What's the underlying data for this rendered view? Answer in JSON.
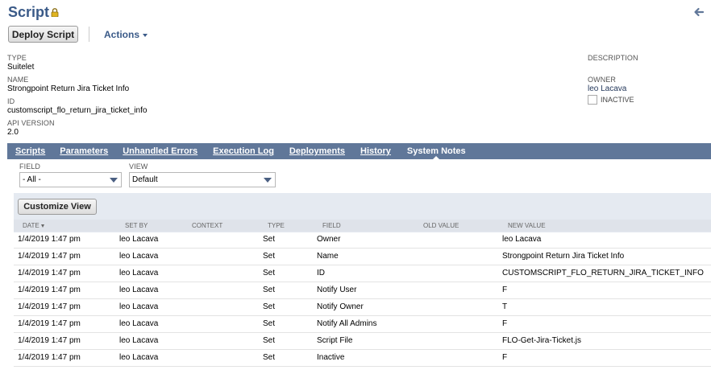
{
  "header": {
    "title": "Script",
    "deploy_label": "Deploy Script",
    "actions_label": "Actions"
  },
  "fields": {
    "type_label": "TYPE",
    "type_value": "Suitelet",
    "name_label": "NAME",
    "name_value": "Strongpoint Return Jira Ticket Info",
    "id_label": "ID",
    "id_value": "customscript_flo_return_jira_ticket_info",
    "api_label": "API VERSION",
    "api_value": "2.0",
    "description_label": "DESCRIPTION",
    "owner_label": "OWNER",
    "owner_value": "leo Lacava",
    "inactive_label": "INACTIVE"
  },
  "tabs": [
    {
      "label": "Scripts"
    },
    {
      "label": "Parameters"
    },
    {
      "label": "Unhandled Errors"
    },
    {
      "label": "Execution Log"
    },
    {
      "label": "Deployments"
    },
    {
      "label": "History"
    },
    {
      "label": "System Notes"
    }
  ],
  "filters": {
    "field_label": "FIELD",
    "field_value": "- All -",
    "view_label": "VIEW",
    "view_value": "Default"
  },
  "grid": {
    "customize_label": "Customize View",
    "columns": [
      "DATE",
      "SET BY",
      "CONTEXT",
      "TYPE",
      "FIELD",
      "OLD VALUE",
      "NEW VALUE"
    ],
    "rows": [
      {
        "date": "1/4/2019 1:47 pm",
        "set_by": "leo Lacava",
        "context": "",
        "type": "Set",
        "field": "Owner",
        "old_value": "",
        "new_value": "leo Lacava"
      },
      {
        "date": "1/4/2019 1:47 pm",
        "set_by": "leo Lacava",
        "context": "",
        "type": "Set",
        "field": "Name",
        "old_value": "",
        "new_value": "Strongpoint Return Jira Ticket Info"
      },
      {
        "date": "1/4/2019 1:47 pm",
        "set_by": "leo Lacava",
        "context": "",
        "type": "Set",
        "field": "ID",
        "old_value": "",
        "new_value": "CUSTOMSCRIPT_FLO_RETURN_JIRA_TICKET_INFO"
      },
      {
        "date": "1/4/2019 1:47 pm",
        "set_by": "leo Lacava",
        "context": "",
        "type": "Set",
        "field": "Notify User",
        "old_value": "",
        "new_value": "F"
      },
      {
        "date": "1/4/2019 1:47 pm",
        "set_by": "leo Lacava",
        "context": "",
        "type": "Set",
        "field": "Notify Owner",
        "old_value": "",
        "new_value": "T"
      },
      {
        "date": "1/4/2019 1:47 pm",
        "set_by": "leo Lacava",
        "context": "",
        "type": "Set",
        "field": "Notify All Admins",
        "old_value": "",
        "new_value": "F"
      },
      {
        "date": "1/4/2019 1:47 pm",
        "set_by": "leo Lacava",
        "context": "",
        "type": "Set",
        "field": "Script File",
        "old_value": "",
        "new_value": "FLO-Get-Jira-Ticket.js"
      },
      {
        "date": "1/4/2019 1:47 pm",
        "set_by": "leo Lacava",
        "context": "",
        "type": "Set",
        "field": "Inactive",
        "old_value": "",
        "new_value": "F"
      }
    ]
  },
  "icons": {
    "lock": "lock-icon",
    "back": "back-arrow-icon",
    "sort": "sort-down-icon",
    "dropdown": "chevron-down-icon"
  },
  "colors": {
    "title": "#3a5a88",
    "tabbar": "#607799",
    "grid_panel": "#e5eaf1",
    "header_row": "#dfe3ea"
  }
}
